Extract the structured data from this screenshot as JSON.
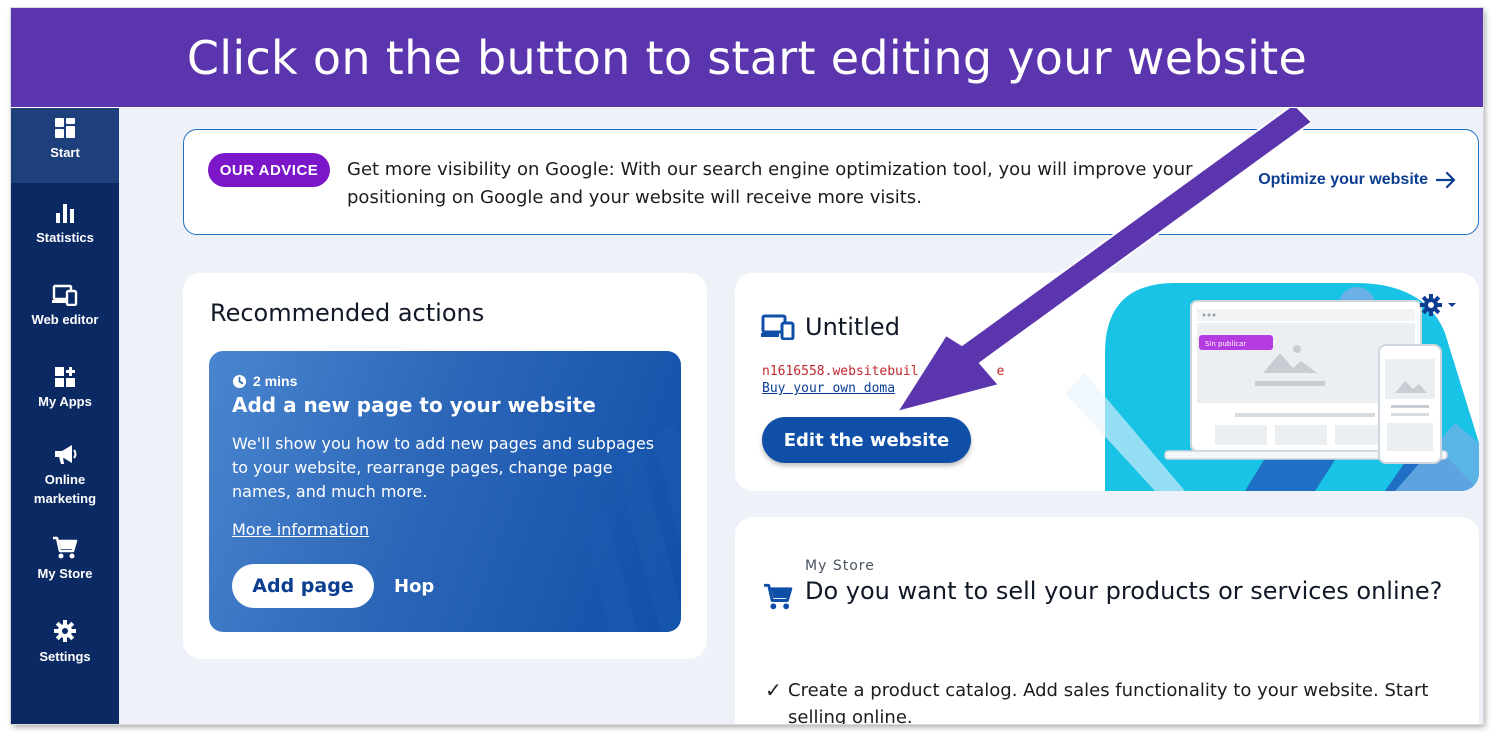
{
  "banner": {
    "text": "Click on the button to start editing your website"
  },
  "sidebar": {
    "items": [
      {
        "label": "Start",
        "icon": "grid-icon",
        "active": true
      },
      {
        "label": "Statistics",
        "icon": "bar-chart-icon",
        "active": false
      },
      {
        "label": "Web editor",
        "icon": "devices-icon",
        "active": false
      },
      {
        "label": "My Apps",
        "icon": "apps-plus-icon",
        "active": false
      },
      {
        "label": "Online marketing",
        "icon": "megaphone-icon",
        "active": false
      },
      {
        "label": "My Store",
        "icon": "cart-icon",
        "active": false
      },
      {
        "label": "Settings",
        "icon": "gear-icon",
        "active": false
      }
    ]
  },
  "advice": {
    "badge": "OUR ADVICE",
    "text": "Get more visibility on Google: With our search engine optimization tool, you will improve your positioning on Google and your website will receive more visits.",
    "link": "Optimize your website"
  },
  "recommended": {
    "title": "Recommended actions",
    "time": "2 mins",
    "heading": "Add a new page to your website",
    "description": "We'll show you how to add new pages and subpages to your website, rearrange pages, change page names, and much more.",
    "more_link": "More information",
    "add_button": "Add page",
    "hop": "Hop"
  },
  "site": {
    "title": "Untitled",
    "url_partial": "n1616558.websitebuil",
    "url_tail": "e",
    "domain_partial": "Buy your own doma",
    "domain_tail": "n",
    "edit_button": "Edit the website",
    "preview_badge": "Sin publicar"
  },
  "store": {
    "label": "My Store",
    "title": "Do you want to sell your products or services online?",
    "check_mark": "✓",
    "check_text": "Create a product catalog. Add sales functionality to your website. Start selling online."
  },
  "colors": {
    "banner": "#5b35ad",
    "sidebar": "#0b2a63",
    "badge": "#7b16c9",
    "primary": "#0f4fa8",
    "url_red": "#c0282d"
  }
}
